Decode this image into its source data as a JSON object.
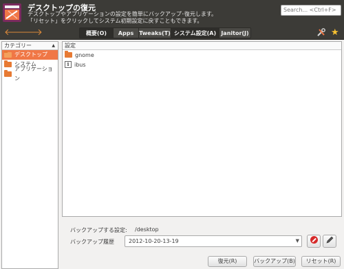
{
  "header": {
    "title": "デスクトップの復元",
    "description_line1": "デスクトップやアプリケーションの設定を簡単にバックアップ･復元します。",
    "description_line2": "「リセット」をクリックしてシステム初期設定に戻すこともできます。",
    "search_placeholder": "Search... <Ctrl+F>"
  },
  "toolbar": {
    "back_icon": "left-arrow-icon",
    "forward_icon": "right-arrow-icon",
    "tabs": [
      {
        "label": "概要(O)"
      },
      {
        "label": "Apps"
      },
      {
        "label": "Tweaks(T)"
      },
      {
        "label": "システム設定(A)"
      },
      {
        "label": "Janitor(J)"
      }
    ],
    "tools_icon": "tools-icon",
    "star_icon": "star-icon"
  },
  "categories": {
    "header": "カテゴリー",
    "items": [
      {
        "label": "デスクトップ",
        "selected": true
      },
      {
        "label": "システム",
        "selected": false
      },
      {
        "label": "アプリケーション",
        "selected": false
      }
    ]
  },
  "settings": {
    "header": "設定",
    "items": [
      {
        "label": "gnome",
        "icon": "folder-icon"
      },
      {
        "label": "ibus",
        "icon": "info-icon"
      }
    ]
  },
  "backup": {
    "setting_label": "バックアップする設定:",
    "setting_value": "/desktop",
    "history_label": "バックアップ履歴",
    "history_value": "2012-10-20-13-19",
    "delete_icon": "delete-icon",
    "edit_icon": "edit-icon"
  },
  "buttons": {
    "restore": "復元(R)",
    "backup": "バックアップ(B)",
    "reset": "リセット(R)"
  },
  "colors": {
    "header_bg": "#3c3b37",
    "accent": "#f07746",
    "folder": "#e77a33"
  }
}
